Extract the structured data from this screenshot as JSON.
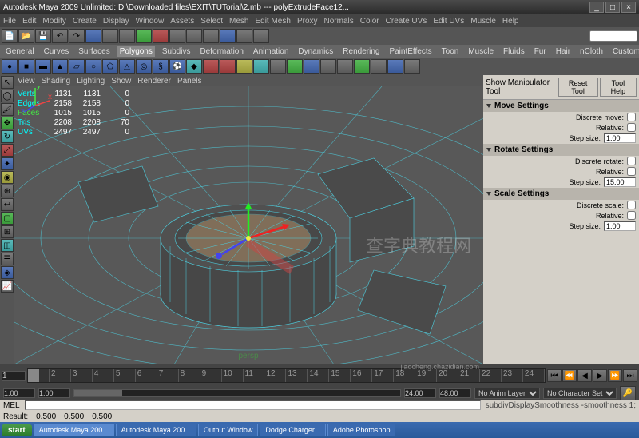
{
  "window": {
    "title": "Autodesk Maya 2009 Unlimited: D:\\Downloaded files\\EXIT\\TUTorial\\2.mb --- polyExtrudeFace12...",
    "editor_label": "polyExtrudeFace12"
  },
  "menus": [
    "File",
    "Edit",
    "Modify",
    "Create",
    "Display",
    "Window",
    "Assets",
    "Select",
    "Mesh",
    "Edit Mesh",
    "Proxy",
    "Normals",
    "Color",
    "Create UVs",
    "Edit UVs",
    "Muscle",
    "Help"
  ],
  "shelf": {
    "tabs": [
      "General",
      "Curves",
      "Surfaces",
      "Polygons",
      "Subdivs",
      "Deformation",
      "Animation",
      "Dynamics",
      "Rendering",
      "PaintEffects",
      "Toon",
      "Muscle",
      "Fluids",
      "Fur",
      "Hair",
      "nCloth",
      "Custom"
    ],
    "active": "Polygons"
  },
  "viewport_menu": [
    "View",
    "Shading",
    "Lighting",
    "Show",
    "Renderer",
    "Panels"
  ],
  "stats": [
    {
      "label": "Verts",
      "a": "1131",
      "b": "1131",
      "c": "0"
    },
    {
      "label": "Edges",
      "a": "2158",
      "b": "2158",
      "c": "0"
    },
    {
      "label": "Faces",
      "a": "1015",
      "b": "1015",
      "c": "0"
    },
    {
      "label": "Tris",
      "a": "2208",
      "b": "2208",
      "c": "70"
    },
    {
      "label": "UVs",
      "a": "2497",
      "b": "2497",
      "c": "0"
    }
  ],
  "persp_label": "persp",
  "right_panel": {
    "title": "Show Manipulator Tool",
    "reset_btn": "Reset Tool",
    "help_btn": "Tool Help",
    "sections": {
      "move": {
        "hdr": "Move Settings",
        "discrete": "Discrete move:",
        "relative": "Relative:",
        "stepsize": "Step size:",
        "stepval": "1.00"
      },
      "rotate": {
        "hdr": "Rotate Settings",
        "discrete": "Discrete rotate:",
        "relative": "Relative:",
        "stepsize": "Step size:",
        "stepval": "15.00"
      },
      "scale": {
        "hdr": "Scale Settings",
        "discrete": "Discrete scale:",
        "relative": "Relative:",
        "stepsize": "Step size:",
        "stepval": "1.00"
      }
    }
  },
  "timeline": {
    "ticks": [
      "1",
      "2",
      "3",
      "4",
      "5",
      "6",
      "7",
      "8",
      "9",
      "10",
      "11",
      "12",
      "13",
      "14",
      "15",
      "16",
      "17",
      "18",
      "19",
      "20",
      "21",
      "22",
      "23",
      "24"
    ],
    "current": "1",
    "range_start": "1.00",
    "range_inner_start": "1.00",
    "range_inner_end": "24.00",
    "range_end": "48.00",
    "anim_layer": "No Anim Layer",
    "char_set": "No Character Set"
  },
  "cmdline": {
    "label": "MEL",
    "hint": "subdivDisplaySmoothness -smoothness 1;"
  },
  "statusbar": {
    "coords": [
      "0.500",
      "0.500",
      "0.500"
    ],
    "label": "Result:"
  },
  "taskbar": {
    "start": "start",
    "tasks": [
      "Autodesk Maya 200...",
      "Autodesk Maya 200...",
      "Output Window",
      "Dodge Charger...",
      "Adobe Photoshop"
    ]
  },
  "watermark": "查字典教程网",
  "watermark2": "jiaocheng.chazidian.com"
}
